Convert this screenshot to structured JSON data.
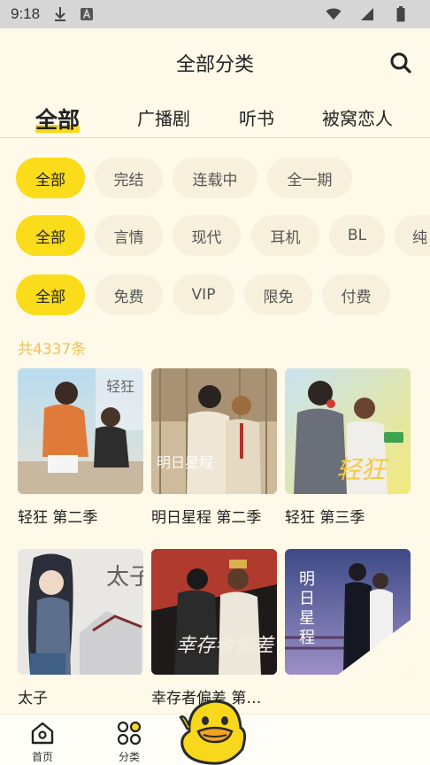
{
  "status_bar": {
    "time": "9:18",
    "icons": [
      "download-icon",
      "a-badge-icon",
      "wifi-icon",
      "signal-icon",
      "battery-icon"
    ]
  },
  "header": {
    "title": "全部分类",
    "search_icon": "search-icon"
  },
  "tabs": [
    {
      "label": "全部",
      "active": true
    },
    {
      "label": "广播剧",
      "active": false
    },
    {
      "label": "听书",
      "active": false
    },
    {
      "label": "被窝恋人",
      "active": false
    }
  ],
  "filters": {
    "status": [
      "全部",
      "完结",
      "连载中",
      "全一期"
    ],
    "genre": [
      "全部",
      "言情",
      "现代",
      "耳机",
      "BL",
      "纯"
    ],
    "price": [
      "全部",
      "免费",
      "VIP",
      "限免",
      "付费"
    ]
  },
  "result_count": "共4337条",
  "works": [
    {
      "title": "轻狂 第二季"
    },
    {
      "title": "明日星程 第二季"
    },
    {
      "title": "轻狂 第三季"
    },
    {
      "title": "太子"
    },
    {
      "title": "幸存者偏差 第…"
    },
    {
      "title": ""
    }
  ],
  "bottom_nav": [
    {
      "label": "首页",
      "icon": "home-icon"
    },
    {
      "label": "分类",
      "icon": "category-icon"
    }
  ],
  "colors": {
    "accent": "#FADC1A",
    "background": "#FEF9E8",
    "chip": "#F7F0DC",
    "count": "#EEC25A"
  }
}
